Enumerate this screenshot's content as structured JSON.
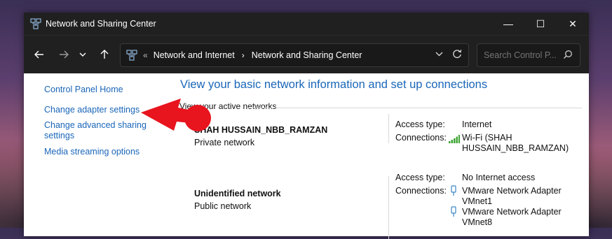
{
  "window": {
    "title": "Network and Sharing Center",
    "controls": {
      "minimize": "—",
      "maximize": "☐",
      "close": "✕"
    }
  },
  "nav": {
    "back": "←",
    "forward": "→",
    "recent": "⌄",
    "up": "↑",
    "breadcrumb_sep": "«",
    "crumbs": [
      "Network and Internet",
      "Network and Sharing Center"
    ],
    "crumb_chevron": "›",
    "search_placeholder": "Search Control P..."
  },
  "sidebar": {
    "items": [
      {
        "label": "Control Panel Home"
      },
      {
        "label": "Change adapter settings"
      },
      {
        "label": "Change advanced sharing settings"
      },
      {
        "label": "Media streaming options"
      }
    ]
  },
  "main": {
    "heading": "View your basic network information and set up connections",
    "section_label": "View your active networks",
    "networks": [
      {
        "name": "SHAH HUSSAIN_NBB_RAMZAN",
        "type": "Private network",
        "access_label": "Access type:",
        "access_value": "Internet",
        "connections_label": "Connections:",
        "connection": "Wi-Fi (SHAH HUSSAIN_NBB_RAMZAN)",
        "connection_icon": "wifi-signal-icon"
      },
      {
        "name": "Unidentified network",
        "type": "Public network",
        "access_label": "Access type:",
        "access_value": "No Internet access",
        "connections_label": "Connections:",
        "connections": [
          "VMware Network Adapter VMnet1",
          "VMware Network Adapter VMnet8"
        ],
        "connection_icon": "ethernet-adapter-icon"
      }
    ]
  },
  "annotation": {
    "color": "#e8141e",
    "icon": "red-arrow-annotation"
  },
  "colors": {
    "titlebar": "#202020",
    "link": "#1a66b8",
    "arrow": "#e8141e"
  }
}
